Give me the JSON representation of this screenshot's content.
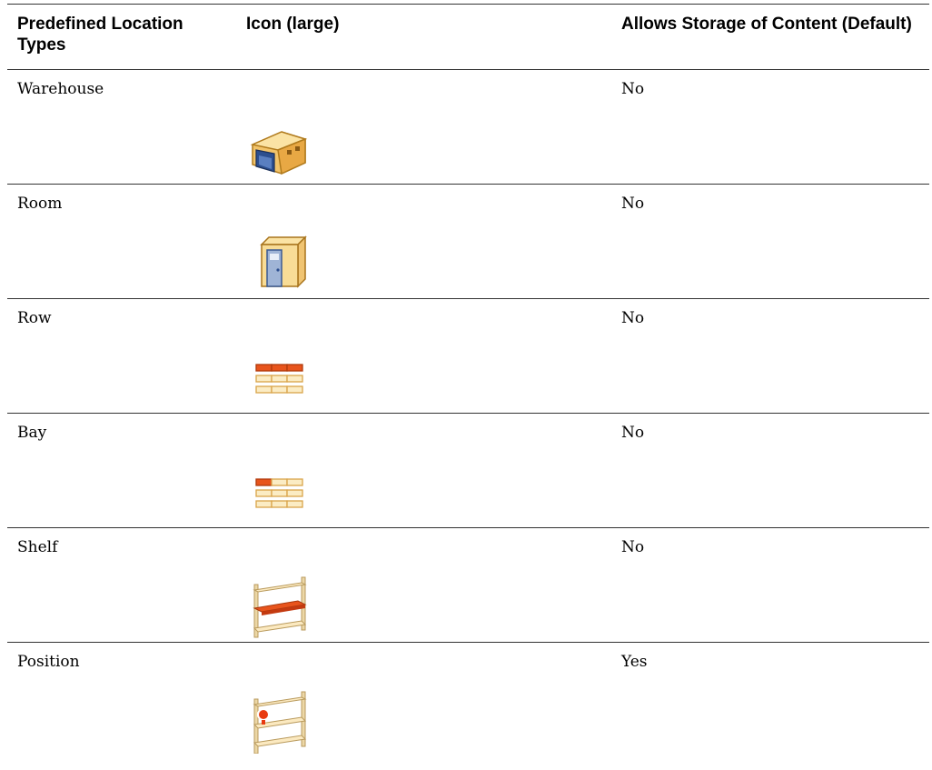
{
  "table": {
    "headers": [
      "Predefined Location Types",
      "Icon (large)",
      "Allows Storage of Content (Default)"
    ],
    "rows": [
      {
        "type": "Warehouse",
        "icon": "warehouse-icon",
        "storage": "No"
      },
      {
        "type": "Room",
        "icon": "room-icon",
        "storage": "No"
      },
      {
        "type": "Row",
        "icon": "row-icon",
        "storage": "No"
      },
      {
        "type": "Bay",
        "icon": "bay-icon",
        "storage": "No"
      },
      {
        "type": "Shelf",
        "icon": "shelf-icon",
        "storage": "No"
      },
      {
        "type": "Position",
        "icon": "position-icon",
        "storage": "Yes"
      }
    ]
  }
}
